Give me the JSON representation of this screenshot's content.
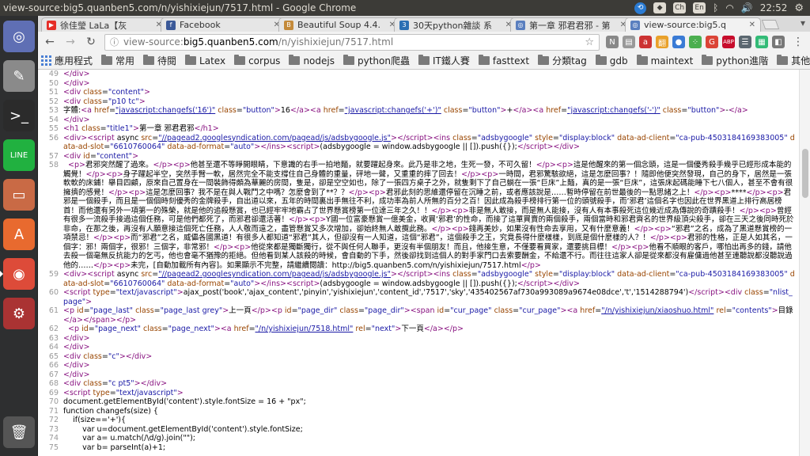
{
  "system": {
    "window_title": "view-source:big5.quanben5.com/n/yishixiejun/7517.html - Google Chrome",
    "tray": [
      "Ch",
      "En"
    ],
    "clock": "22:52"
  },
  "launcher": [
    {
      "name": "ubuntu-dash-icon",
      "glyph": "◎",
      "color": "#5f6fb4"
    },
    {
      "name": "text-editor-icon",
      "glyph": "✎",
      "color": "#8a8a8a"
    },
    {
      "name": "terminal-icon",
      "glyph": ">_",
      "color": "#2b2b2b"
    },
    {
      "name": "line-app-icon",
      "glyph": "LINE",
      "color": "#21b140"
    },
    {
      "name": "file-manager-icon",
      "glyph": "▭",
      "color": "#c96a45"
    },
    {
      "name": "software-center-icon",
      "glyph": "A",
      "color": "#e86a2f"
    },
    {
      "name": "chrome-icon",
      "glyph": "◉",
      "color": "#dd4b39"
    },
    {
      "name": "system-settings-icon",
      "glyph": "⚙",
      "color": "#a33"
    },
    {
      "name": "trash-icon",
      "glyph": "🗑",
      "color": "#555"
    }
  ],
  "tabs": [
    {
      "label": "徐佳瑩 LaLa【灰",
      "fav_color": "#e52d27",
      "fav_glyph": "▶"
    },
    {
      "label": "Facebook",
      "fav_color": "#3b5998",
      "fav_glyph": "f"
    },
    {
      "label": "Beautiful Soup 4.4.",
      "fav_color": "#c48a3a",
      "fav_glyph": "B"
    },
    {
      "label": "30天python雜談 系",
      "fav_color": "#2b6fb3",
      "fav_glyph": "3"
    },
    {
      "label": "第一章 邪君君邪 - 第",
      "fav_color": "#5a7fbf",
      "fav_glyph": "◎"
    },
    {
      "label": "view-source:big5.q",
      "fav_color": "#5a7fbf",
      "fav_glyph": "◎"
    }
  ],
  "omnibox": {
    "scheme": "view-source:",
    "host": "big5.quanben5.com",
    "path": "/n/yishixiejun/7517.html"
  },
  "extensions": [
    {
      "name": "nextjump-extension-icon",
      "glyph": "N",
      "color": "#888"
    },
    {
      "name": "reader-extension-icon",
      "glyph": "▤",
      "color": "#999"
    },
    {
      "name": "grammar-extension-icon",
      "glyph": "a",
      "color": "#c33"
    },
    {
      "name": "dictionary-extension-icon",
      "glyph": "翻",
      "color": "#e9a12b"
    },
    {
      "name": "blue-extension-icon",
      "glyph": "●",
      "color": "#3a7bd5"
    },
    {
      "name": "dots-extension-icon",
      "glyph": "⁘",
      "color": "#4caf50"
    },
    {
      "name": "google-extension-icon",
      "glyph": "G",
      "color": "#db4437"
    },
    {
      "name": "abp-extension-icon",
      "glyph": "ABP",
      "color": "#c70d2c"
    },
    {
      "name": "menu-extension-icon",
      "glyph": "☰",
      "color": "#5b6770"
    },
    {
      "name": "chart-extension-icon",
      "glyph": "▦",
      "color": "#3b7"
    },
    {
      "name": "more-extension-icon",
      "glyph": "◧",
      "color": "#777"
    }
  ],
  "bookmarks": {
    "apps": "應用程式",
    "folders": [
      "常用",
      "待閱",
      "Latex",
      "corpus",
      "nodejs",
      "python爬蟲",
      "IT鐵人賽",
      "fasttext",
      "分類tag",
      "gdb",
      "maintext",
      "python進階"
    ],
    "other": "其他書籤"
  },
  "source_lines": [
    {
      "n": "49",
      "html": "&lt;/div&gt;"
    },
    {
      "n": "50",
      "html": "&lt;/div&gt;"
    },
    {
      "n": "51",
      "html": "&lt;div class=\"content\"&gt;"
    },
    {
      "n": "52",
      "html": "&lt;div class=\"p10 tc\"&gt;"
    },
    {
      "n": "53",
      "html": "字體:&lt;a href=\"javascript:changefs('16')\" class=\"button\"&gt;16&lt;/a&gt;&lt;a href=\"javascript:changefs('+')\" class=\"button\"&gt;+&lt;/a&gt;&lt;a href=\"javascript:changefs('-')\" class=\"button\"&gt;-&lt;/a&gt;"
    },
    {
      "n": "54",
      "html": "&lt;/div&gt;"
    },
    {
      "n": "55",
      "html": "&lt;h1 class=\"title1\"&gt;第一章 邪君君邪&lt;/h1&gt;"
    },
    {
      "n": "56",
      "html": "&lt;div&gt;&lt;script async src=\"//pagead2.googlesyndication.com/pagead/js/adsbygoogle.js\"&gt;&lt;/script&gt;&lt;ins class=\"adsbygoogle\" style=\"display:block\" data-ad-client=\"ca-pub-4503184169383005\" data-ad-slot=\"6610760064\" data-ad-format=\"auto\"&gt;&lt;/ins&gt;&lt;script&gt;(adsbygoogle = window.adsbygoogle || []).push({});&lt;/script&gt;&lt;/div&gt;"
    },
    {
      "n": "57",
      "html": "&lt;div id=\"content\"&gt;"
    },
    {
      "n": "58",
      "html": "  &lt;p&gt;君邪突然醒了過來。&lt;/p&gt;&lt;p&gt;他甚至還不等睜開眼睛，下意識的右手一拍地麵，就要躍起身來。此乃是非之地，生死一發，不可久留！&lt;/p&gt;&lt;p&gt;這是他醒來的第一個念頭，這是一個優秀殺手幾乎已經形成本能的觸覺！&lt;/p&gt;&lt;p&gt;身子躍起半空，突然手臂一軟，居然完全不能支撐住自己身體的重量，砰地一聲，又重重的摔了回去！&lt;/p&gt;&lt;p&gt;一時間，君邪驚駭欲絕，這是怎麼回事？！隨即他便突然發現，自己的身下，居然是一張軟軟的床鋪！舉目四顧，原來自己置身在一間裝飾得頗為華麗的房間，隻是，卻是空空如也，除了一張四方桌子之外，就隻剩下了自己躺在一張“巨床”上麵，真的是一張“巨床”，這張床起碼能睡下七八個人，甚至不會有很擁擠的感覺！&lt;/p&gt;&lt;p&gt;這是怎麼回事？我不是在與人戰鬥之中嗎？怎麼會到了**？？&lt;/p&gt;&lt;p&gt;君邪此刻的思維還停留在沉睡之前，或者應該說是……暫時停留在前世最後的一點思緒之上！&lt;/p&gt;&lt;p&gt;****&lt;/p&gt;&lt;p&gt;君邪是一個殺手，而且是一個個時刻優秀的金牌殺手，自出道以來，五年的時間裏出手無往不利，成功率為前人所無的百分之百！因此成為殺手榜排行第一位的頭號殺手，而‘邪君’這個名字也因此在世界黑道上排行高居榜首！而他還有另外一項第一的殊榮，就是他的追殺懸賞，也已經牢牢地霸占了世界懸賞榜第一位達三年之久！！&lt;/p&gt;&lt;p&gt;非是無人敢接，而是無人能接，沒有人有本事殺死這位幾近成為傳說的奇蹟殺手！&lt;/p&gt;&lt;p&gt;曾經有很多一流殺手接過這個任務，可是他們都死了，而邪君卻還活著！&lt;/p&gt;&lt;p&gt;Y國一位富豪懸賞一億美金，收買‘邪君’的性命，而接了這單買賣的兩個殺手，兩個當時和邪君齊名的世界級頂尖殺手，卻在三天之後同時死於非命，在那之後，再沒有人願意接這個死亡任務，人人敬而遠之，盡管懸賞又多次增加，卻始終無人敢攬此務。&lt;/p&gt;&lt;p&gt;錢再美妙，如果沒有性命去享用，又有什麼意義！&lt;/p&gt;&lt;p&gt;“邪君”之名，成為了黑道懸賞榜的一項禁忌！&lt;/p&gt;&lt;p&gt;而“邪君”之名，威儡各國黑道！有很多人都知道“邪君”其人，但卻沒有一人知道，這個“邪君”，這個殺手之王，究竟長得什麼樣樣，到底是個什麼樣的人？！&lt;/p&gt;&lt;p&gt;君邪的性格，正是人如其名，一個字：邪！兩個字，很邪！三個字，非常邪！&lt;/p&gt;&lt;p&gt;他從來都是獨斷獨行，從不與任何人聯手，更沒有半個朋友！而且，他接生意，不僅要看買家，還要挑目標！&lt;/p&gt;&lt;p&gt;他看不順眼的客戶，哪怕出再多的錢，請他去殺一個毫無反抗能力的乞丐，他也會毫不猶豫的拒絕。但他看到某人該殺的時候，會自動的下手，然後卻找到這個人的對手家門口去索要酬金，不給還不行。而往往這家人卻是從來都沒有雇傭過他甚至連聽說都沒聽說過他的……&lt;/p&gt;&lt;p&gt;未完，[自動加載所有內容]。如果顯示不完整，請繼續閱讀：http://big5.quanben5.com/n/yishixiejun/7517.html&lt;/p&gt;"
    },
    {
      "n": "59",
      "html": "&lt;div&gt;&lt;script async src=\"//pagead2.googlesyndication.com/pagead/js/adsbygoogle.js\"&gt;&lt;/script&gt;&lt;ins class=\"adsbygoogle\" style=\"display:block\" data-ad-client=\"ca-pub-4503184169383005\" data-ad-slot=\"6610760064\" data-ad-format=\"auto\"&gt;&lt;/ins&gt;&lt;script&gt;(adsbygoogle = window.adsbygoogle || []).push({});&lt;/script&gt;&lt;/div&gt;"
    },
    {
      "n": "60",
      "html": "&lt;script type=\"text/javascript\"&gt;ajax_post('book','ajax_content','pinyin','yishixiejun','content_id','7517','sky','435402567af730a993089a9674e08dce','t','1514288794')&lt;/script&gt;&lt;div class=\"nlist_page\"&gt;"
    },
    {
      "n": "61",
      "html": "&lt;p id=\"page_last\" class=\"page_last grey\"&gt;上一頁&lt;/p&gt;&lt;p id=\"page_dir\" class=\"page_dir\"&gt;&lt;span id=\"cur_page\" class=\"cur_page\"&gt;&lt;a href=\"/n/yishixiejun/xiaoshuo.html\" rel=\"contents\"&gt;目錄&lt;/a&gt;&lt;/span&gt;&lt;/p&gt;"
    },
    {
      "n": "62",
      "html": "  &lt;p id=\"page_next\" class=\"page_next\"&gt;&lt;a href=\"/n/yishixiejun/7518.html\" rel=\"next\"&gt;下一頁&lt;/a&gt;&lt;/p&gt;"
    },
    {
      "n": "63",
      "html": "&lt;/div&gt;"
    },
    {
      "n": "64",
      "html": "&lt;/div&gt;"
    },
    {
      "n": "65",
      "html": "&lt;div class=\"c\"&gt;&lt;/div&gt;"
    },
    {
      "n": "66",
      "html": "&lt;/div&gt;"
    },
    {
      "n": "67",
      "html": "&lt;/div&gt;"
    },
    {
      "n": "68",
      "html": "&lt;div class=\"c pt5\"&gt;&lt;/div&gt;"
    },
    {
      "n": "69",
      "html": "&lt;script type=\"text/javascript\"&gt;"
    },
    {
      "n": "70",
      "html": "document.getElementById('content').style.fontSize = 16 + \"px\";"
    },
    {
      "n": "71",
      "html": "function changefs(size) {"
    },
    {
      "n": "72",
      "html": "    if(size=='+'){"
    },
    {
      "n": "73",
      "html": "        var u=document.getElementById('content').style.fontSize;"
    },
    {
      "n": "74",
      "html": "        var a= u.match(/\\d/g).join(\"\");"
    },
    {
      "n": "75",
      "html": "        var b= parseInt(a)+1;"
    }
  ]
}
